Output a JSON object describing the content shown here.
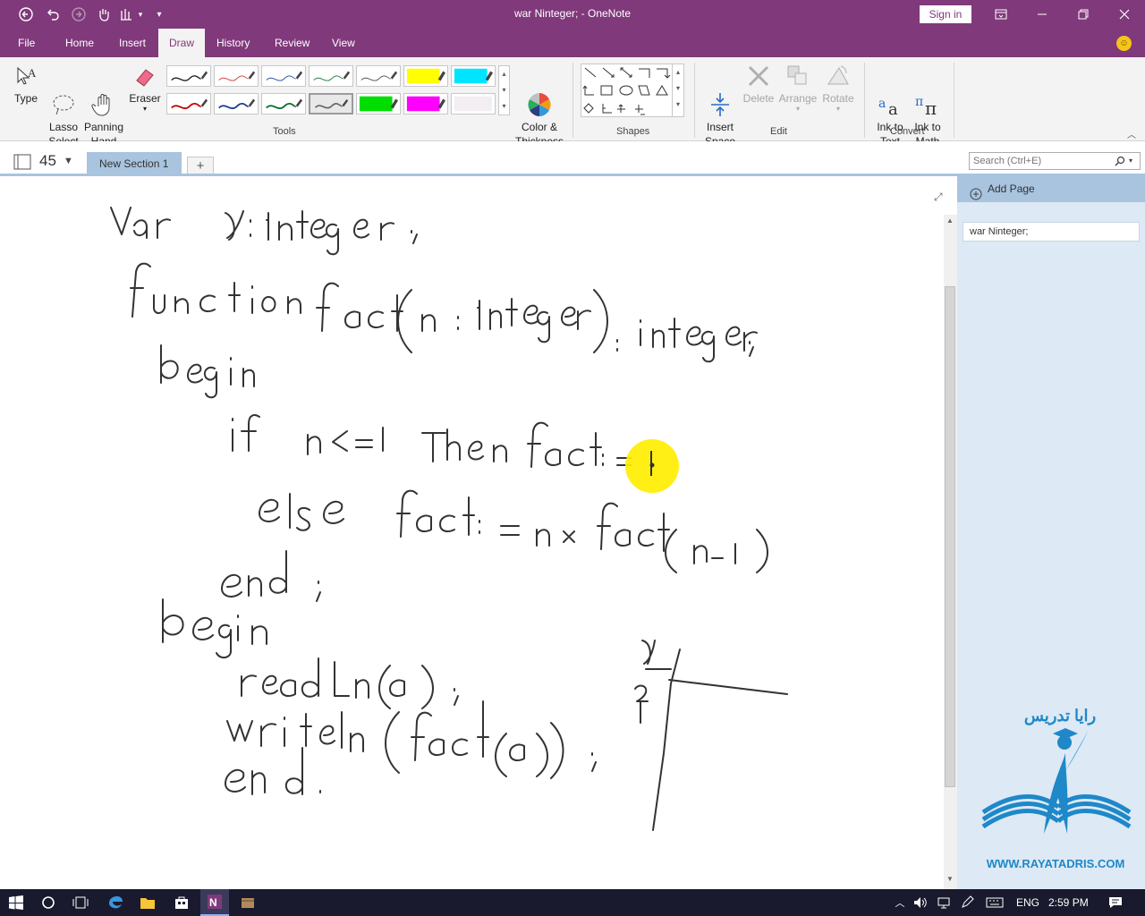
{
  "titlebar": {
    "title": "war Ninteger;  -  OneNote",
    "signin": "Sign in",
    "accent": "#80397b"
  },
  "menu": {
    "tabs": [
      "File",
      "Home",
      "Insert",
      "Draw",
      "History",
      "Review",
      "View"
    ],
    "active": "Draw"
  },
  "ribbon": {
    "type": "Type",
    "lasso": "Lasso\nSelect",
    "panning": "Panning\nHand",
    "eraser": "Eraser",
    "color_thickness": "Color &\nThickness",
    "insert_space": "Insert\nSpace",
    "delete": "Delete",
    "arrange": "Arrange",
    "rotate": "Rotate",
    "ink_to_text": "Ink to\nText",
    "ink_to_math": "Ink to\nMath",
    "groups": {
      "tools": "Tools",
      "shapes": "Shapes",
      "edit": "Edit",
      "convert": "Convert"
    }
  },
  "pens": {
    "row1": [
      "#222222",
      "#d04040",
      "#3050a0",
      "#208040",
      "#555555",
      "#ffff00",
      "#00e5ff"
    ],
    "row2": [
      "#c00000",
      "#1a3a8a",
      "#0a6a2a",
      "#666666",
      "#00dd00",
      "#ff00ff",
      "#f2eef2"
    ]
  },
  "pagebar": {
    "page_count": "45",
    "section": "New Section 1",
    "add": "+",
    "search_placeholder": "Search (Ctrl+E)"
  },
  "pages": {
    "add_page": "Add Page",
    "items": [
      "war Ninteger;"
    ]
  },
  "watermark": {
    "name": "رایا تدریس",
    "url": "WWW.RAYATADRIS.COM"
  },
  "taskbar": {
    "lang": "ENG",
    "time": "2:59 PM"
  }
}
